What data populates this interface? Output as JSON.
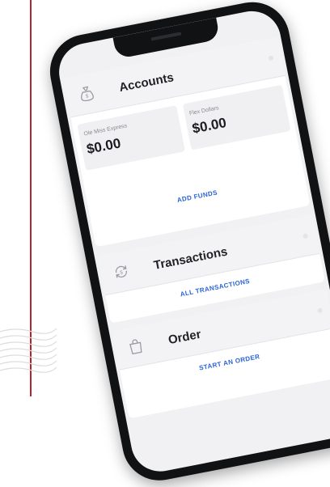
{
  "accounts": {
    "title": "Accounts",
    "icon": "money-bag-icon",
    "balances": [
      {
        "label": "Ole Miss Express",
        "amount": "$0.00"
      },
      {
        "label": "Flex Dollars",
        "amount": "$0.00"
      }
    ],
    "action": "ADD FUNDS"
  },
  "transactions": {
    "title": "Transactions",
    "icon": "refresh-cycle-icon",
    "action": "ALL TRANSACTIONS"
  },
  "order": {
    "title": "Order",
    "icon": "shopping-bag-icon",
    "action": "START AN ORDER"
  },
  "colors": {
    "accent_link": "#2a63d8",
    "brand_rule": "#b5232e",
    "phone_frame": "#111214"
  }
}
